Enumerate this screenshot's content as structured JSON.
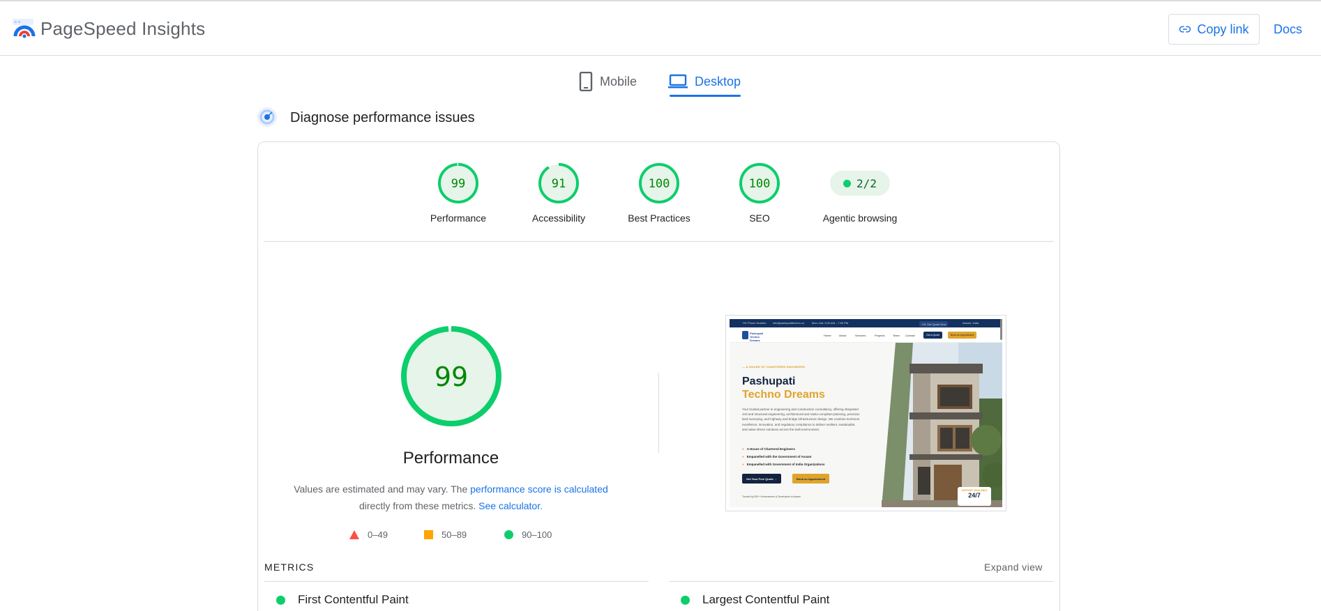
{
  "app": {
    "title": "PageSpeed Insights"
  },
  "header": {
    "copy_link": "Copy link",
    "docs": "Docs"
  },
  "tabs": [
    {
      "label": "Mobile",
      "active": false
    },
    {
      "label": "Desktop",
      "active": true
    }
  ],
  "section": {
    "title": "Diagnose performance issues"
  },
  "scores": [
    {
      "label": "Performance",
      "value": "99",
      "score": 0.99
    },
    {
      "label": "Accessibility",
      "value": "91",
      "score": 0.91
    },
    {
      "label": "Best Practices",
      "value": "100",
      "score": 1.0
    },
    {
      "label": "SEO",
      "value": "100",
      "score": 1.0
    }
  ],
  "agentic": {
    "label": "Agentic browsing",
    "value": "2/2"
  },
  "performance": {
    "value": "99",
    "score": 0.99,
    "title": "Performance",
    "note_prefix": "Values are estimated and may vary. The ",
    "note_link": "performance score is calculated",
    "note_middle": "directly from these metrics.",
    "note_calc": "See calculator."
  },
  "legend": {
    "poor": "0–49",
    "average": "50–89",
    "good": "90–100"
  },
  "thumbnail": {
    "topbar": [
      "+91 Phone Number",
      "info@pashupatitechno.co",
      "Mon–Sat: 9:00 AM – 7:00 PM"
    ],
    "topbar_btn1": "+91 Get Quote Now",
    "topbar_btn2": "Assam, India",
    "logo": "Pashupati Techno Dreams",
    "menu": [
      "Home",
      "About",
      "Services",
      "Projects",
      "Team",
      "Contact"
    ],
    "cta1": "Get a Quote",
    "cta2": "Book an Appointment",
    "kicker": "— A HOUSE OF CHARTERED ENGINEERS",
    "h1_line1": "Pashupati",
    "h1_line2": "Techno Dreams",
    "paragraph": "Your trusted partner in engineering and construction consultancy, offering integrated civil and structural engineering, architectural and Vastu-compliant planning, precision land surveying, and highway and bridge infrastructure design. We combine technical excellence, innovation, and regulatory compliance to deliver resilient, sustainable, and value-driven solutions across the built environment.",
    "bullets": [
      "A House of Chartered Engineers",
      "Empanelled with the Government of Assam",
      "Empanelled with Government of India Organizations"
    ],
    "btn_primary": "Get Your Free Quote →",
    "btn_secondary": "Book an Appointment",
    "trust": "Trusted by 500+ Homeowners & Developers in Assam",
    "badge_top": "SUPPORT AVAILABLE",
    "badge_main": "24/7"
  },
  "metrics": {
    "title": "METRICS",
    "expand": "Expand view",
    "items": [
      "First Contentful Paint",
      "Largest Contentful Paint"
    ]
  },
  "colors": {
    "good": "#0cce6b",
    "good_dark": "#008800",
    "good_bg": "#e6f4ea",
    "average": "#ffa400",
    "poor": "#ff4e42",
    "accent": "#1a73e8"
  }
}
